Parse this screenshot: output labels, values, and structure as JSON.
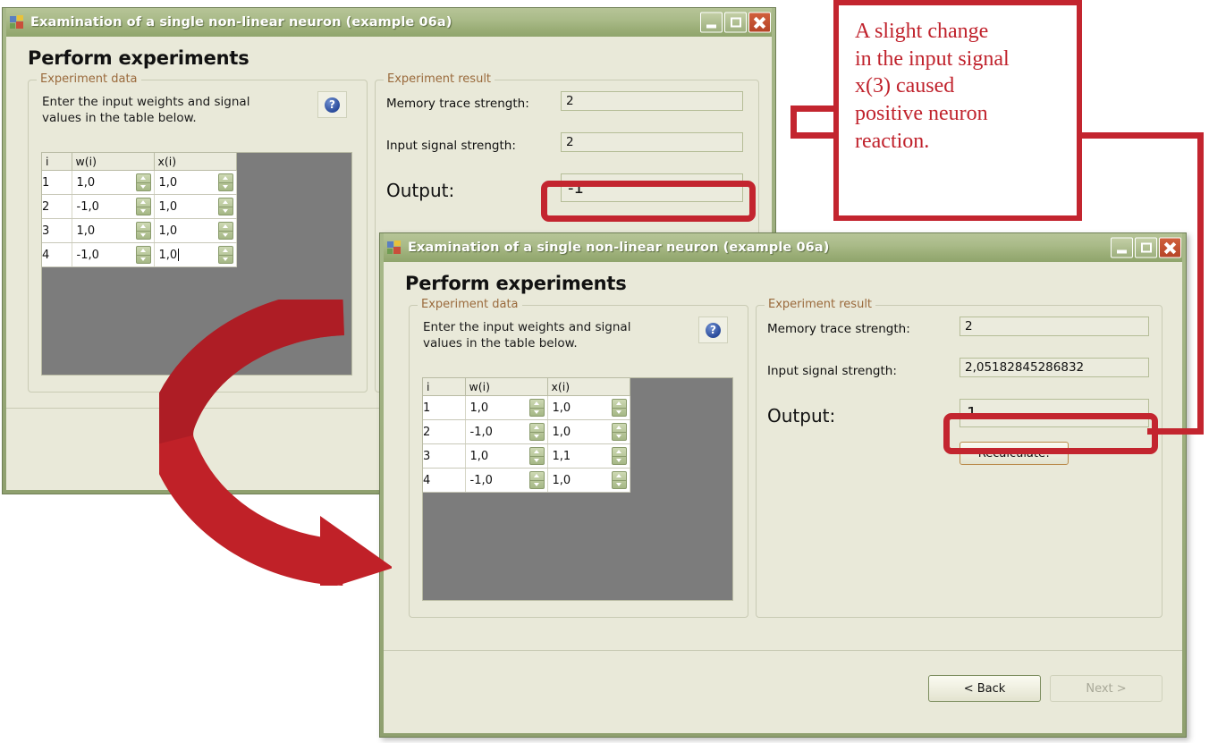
{
  "window_title": "Examination of a single non-linear neuron (example 06a)",
  "page_heading": "Perform experiments",
  "groups": {
    "data_legend": "Experiment data",
    "result_legend": "Experiment result",
    "instructions": "Enter the input weights and signal values in the table below.",
    "help_glyph": "?"
  },
  "table": {
    "headers": [
      "i",
      "w(i)",
      "x(i)"
    ]
  },
  "window1": {
    "rows": [
      {
        "i": "1",
        "w": "1,0",
        "x": "1,0"
      },
      {
        "i": "2",
        "w": "-1,0",
        "x": "1,0"
      },
      {
        "i": "3",
        "w": "1,0",
        "x": "1,0"
      },
      {
        "i": "4",
        "w": "-1,0",
        "x": "1,0"
      }
    ],
    "memory_trace_label": "Memory trace strength:",
    "memory_trace_value": "2",
    "input_signal_label": "Input signal strength:",
    "input_signal_value": "2",
    "output_label": "Output:",
    "output_value": "-1"
  },
  "window2": {
    "rows": [
      {
        "i": "1",
        "w": "1,0",
        "x": "1,0"
      },
      {
        "i": "2",
        "w": "-1,0",
        "x": "1,0"
      },
      {
        "i": "3",
        "w": "1,0",
        "x": "1,1"
      },
      {
        "i": "4",
        "w": "-1,0",
        "x": "1,0"
      }
    ],
    "memory_trace_label": "Memory trace strength:",
    "memory_trace_value": "2",
    "input_signal_label": "Input signal strength:",
    "input_signal_value": "2,05182845286832",
    "output_label": "Output:",
    "output_value": "1",
    "recalculate_label": "Recalculate!",
    "back_label": "< Back",
    "next_label": "Next >"
  },
  "annotation": {
    "lines": [
      "A slight change",
      "in the input signal",
      "x(3) caused",
      "positive neuron",
      "reaction."
    ]
  },
  "colors": {
    "accent_red": "#c3252f",
    "title_bar": "#9aad76",
    "legend_text": "#9a6a3c",
    "window_face": "#e9e9d9"
  }
}
